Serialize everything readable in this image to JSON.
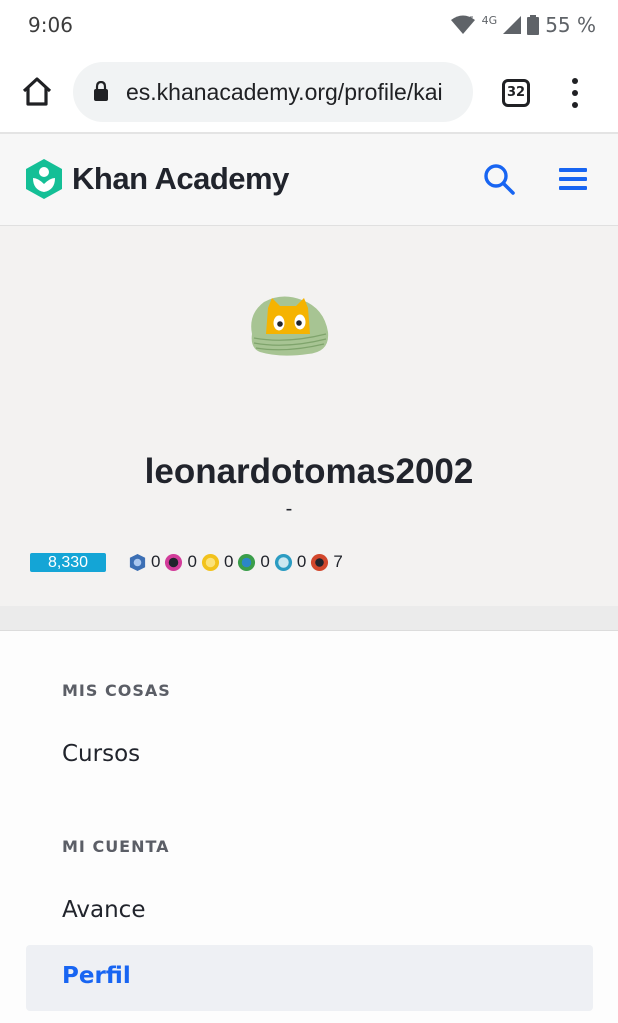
{
  "status_bar": {
    "time": "9:06",
    "network": "4G",
    "battery": "55 %"
  },
  "browser": {
    "url": "es.khanacademy.org/profile/kai",
    "tab_count": "32"
  },
  "site_header": {
    "brand": "Khan Academy",
    "brand_color": "#14bf96",
    "accent_color": "#1865f2"
  },
  "profile": {
    "username": "leonardotomas2002",
    "bio": "-",
    "points": "8,330",
    "badges": [
      {
        "icon": "meteorite-badge-icon",
        "color": "#3c6fb4",
        "count": "0"
      },
      {
        "icon": "moon-badge-icon",
        "color": "#d23c9a",
        "count": "0"
      },
      {
        "icon": "earth-badge-icon",
        "color": "#f2c21c",
        "count": "0"
      },
      {
        "icon": "sun-badge-icon",
        "color": "#3a9e4a",
        "count": "0"
      },
      {
        "icon": "black-hole-badge-icon",
        "color": "#2b9cc2",
        "count": "0"
      },
      {
        "icon": "challenge-patch-icon",
        "color": "#d2472c",
        "count": "7"
      }
    ]
  },
  "menu": {
    "section_mine": "MIS COSAS",
    "courses": "Cursos",
    "section_account": "MI CUENTA",
    "progress": "Avance",
    "profile": "Perfil"
  }
}
